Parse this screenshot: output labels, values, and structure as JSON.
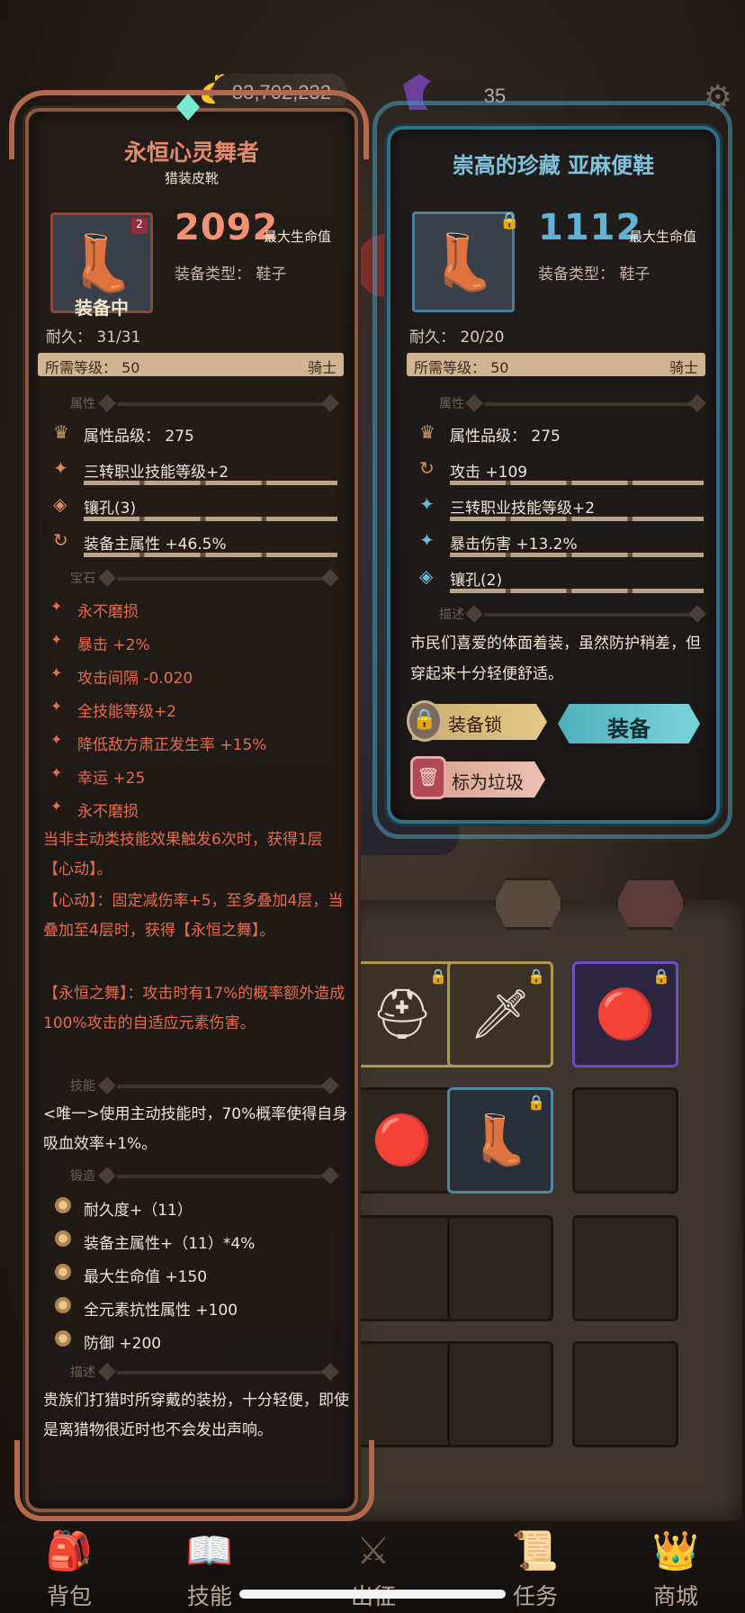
{
  "currency": {
    "gold": "83,702,232",
    "gems": "35"
  },
  "equipped_item": {
    "name": "永恒心灵舞者",
    "subtitle": "猎装皮靴",
    "badge": "2",
    "status": "装备中",
    "main_value": "2092",
    "main_value_label": "最大生命值",
    "type_line": "装备类型：  鞋子",
    "durability": "耐久：  31/31",
    "required_level": "所需等级：  50",
    "class": "骑士",
    "sections": {
      "attributes": "属性",
      "gems": "宝石",
      "skills": "技能",
      "forge": "锻造",
      "description": "描述"
    },
    "attributes": [
      {
        "icon": "quality-icon",
        "text": "属性品级：  275"
      },
      {
        "icon": "star-icon",
        "text": "三转职业技能等级+2"
      },
      {
        "icon": "socket-icon",
        "text": "镶孔(3)"
      },
      {
        "icon": "cycle-icon",
        "text": "装备主属性 +46.5%"
      }
    ],
    "gems": [
      "永不磨损",
      "暴击 +2%",
      "攻击间隔 -0.020",
      "全技能等级+2",
      "降低敌方肃正发生率 +15%",
      "幸运 +25",
      "永不磨损"
    ],
    "effect_text": [
      "当非主动类技能效果触发6次时，获得1层【心动】。",
      "【心动】：固定减伤率+5，至多叠加4层，当叠加至4层时，获得【永恒之舞】。",
      "【永恒之舞】：攻击时有17%的概率额外造成100%攻击的自适应元素伤害。"
    ],
    "skill_text": "<唯一>使用主动技能时，70%概率使得自身吸血效率+1%。",
    "forge": [
      "耐久度+（11）",
      "装备主属性+（11）*4%",
      "最大生命值 +150",
      "全元素抗性属性 +100",
      "防御 +200"
    ],
    "description": "贵族们打猎时所穿戴的装扮，十分轻便，即使是离猎物很近时也不会发出声响。"
  },
  "compare_item": {
    "name": "崇高的珍藏 亚麻便鞋",
    "main_value": "1112",
    "main_value_label": "最大生命值",
    "type_line": "装备类型：  鞋子",
    "durability": "耐久：  20/20",
    "required_level": "所需等级：  50",
    "class": "骑士",
    "sections": {
      "attributes": "属性",
      "description": "描述"
    },
    "attributes": [
      {
        "icon": "quality-icon",
        "text": "属性品级：  275"
      },
      {
        "icon": "cycle-icon",
        "text": "攻击 +109"
      },
      {
        "icon": "star-icon",
        "text": "三转职业技能等级+2"
      },
      {
        "icon": "star-icon",
        "text": "暴击伤害 +13.2%"
      },
      {
        "icon": "socket-icon",
        "text": "镶孔(2)"
      }
    ],
    "description": "市民们喜爱的体面着装，虽然防护稍差，但穿起来十分轻便舒适。",
    "buttons": {
      "lock": "装备锁",
      "equip": "装备",
      "trash": "标为垃圾"
    }
  },
  "bottom_nav": [
    {
      "label": "背包",
      "icon": "backpack-icon"
    },
    {
      "label": "技能",
      "icon": "skill-book-icon"
    },
    {
      "label": "出征",
      "icon": "battle-icon"
    },
    {
      "label": "任务",
      "icon": "quest-icon"
    },
    {
      "label": "商城",
      "icon": "shop-icon"
    }
  ],
  "colors": {
    "equipped_accent": "#e38a6c",
    "compare_accent": "#7fc3dc",
    "gem_text": "#e56c4e"
  }
}
